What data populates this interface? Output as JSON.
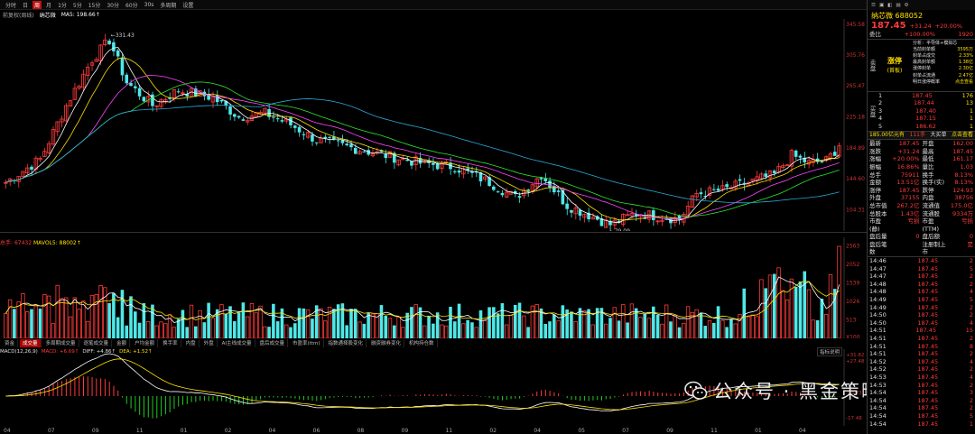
{
  "toolbar": {
    "items": [
      "分时",
      "日",
      "周",
      "月",
      "1分",
      "5分",
      "15分",
      "30分",
      "60分",
      "30s",
      "多周期",
      "设置"
    ],
    "active_index": 2
  },
  "titlebar": {
    "left": "前复权(周线)",
    "name": "纳芯微",
    "ma": "MA5: 198.66↑"
  },
  "main_chart": {
    "price_axis": [
      "345.58",
      "305.76",
      "265.47",
      "225.18",
      "184.89",
      "144.60",
      "104.31"
    ],
    "high_annotation": "←331.43",
    "low_annotation": "←79.09"
  },
  "vol_chart": {
    "title_prefix": "总手: ",
    "title_value": "67432",
    "title_ma": "MAVOL5: 88002↑",
    "axis": [
      "2563",
      "2052",
      "1539",
      "1026",
      "513",
      "X100"
    ]
  },
  "indicator_tabs": {
    "items": [
      "资金",
      "成交量",
      "多周期成交量",
      "逐笔成交量",
      "金额",
      "户均金额",
      "换手率",
      "内盘",
      "外盘",
      "AI主线成交量",
      "盘后成交量",
      "市盈率(ttm)",
      "指数通择股变化",
      "融资融券变化",
      "机构持仓数"
    ],
    "active_index": 1,
    "right_button": "指标说明"
  },
  "macd": {
    "prefix": "MACD(12,26,9)",
    "macd_val": "MACD: +6.69↑",
    "diff": "DIFF: +4.86↑",
    "dea": "DEA: +1.52↑",
    "axis": [
      "+31.82",
      "+27.48",
      "-13.73",
      "-17.48"
    ]
  },
  "dates": [
    "04",
    "07",
    "09",
    "11",
    "01",
    "02",
    "04",
    "06",
    "08",
    "09",
    "11",
    "02",
    "04",
    "05",
    "07",
    "09",
    "11",
    "01",
    "04"
  ],
  "chart_data": {
    "type": "candlestick",
    "y_range": [
      79.09,
      345.58
    ],
    "high": 331.43,
    "low": 79.09,
    "last_close": 187.45,
    "ma5": 198.66,
    "volume_last": 67432,
    "mavol5": 88002,
    "macd": 6.69,
    "diff": 4.86,
    "dea": 1.52
  },
  "quote": {
    "name": "纳芯微 688052",
    "price": "187.45",
    "change": "+31.24",
    "pct": "+20.00%",
    "weibi_label": "委比",
    "weibi": "+100.00%",
    "weibi_amt": "1920",
    "zt_label": "涨停",
    "zt_sub": "(首板)",
    "fenxi": "分析：半导体+模拟芯",
    "stats": [
      [
        "当前封单额",
        "3595万"
      ],
      [
        "封单占成交",
        "2.33%"
      ],
      [
        "最高封单额",
        "1.38亿"
      ],
      [
        "涨停封单",
        "2.30亿"
      ],
      [
        "封单占流通",
        "2.47亿"
      ],
      [
        "明日涨停概率",
        "点击查看"
      ]
    ],
    "side_sell": "卖盘",
    "side_buy": "买盘",
    "buy_levels": [
      [
        "1",
        "187.45",
        "176"
      ],
      [
        "2",
        "187.44",
        "13"
      ],
      [
        "3",
        "187.40",
        "1"
      ],
      [
        "4",
        "187.15",
        "1"
      ],
      [
        "5",
        "186.62",
        "1"
      ]
    ],
    "big_order": {
      "a": "185.00亿元有",
      "b": "111手",
      "c": "大买单",
      "d": "点击查看"
    },
    "fields": [
      [
        "最新",
        "187.45",
        "开盘",
        "162.00"
      ],
      [
        "涨跌",
        "+31.24",
        "最高",
        "187.45"
      ],
      [
        "涨幅",
        "+20.00%",
        "最低",
        "161.17"
      ],
      [
        "振幅",
        "16.86%",
        "量比",
        "1.03"
      ],
      [
        "总手",
        "75911",
        "换手",
        "8.13%"
      ],
      [
        "金额",
        "13.51亿",
        "换手(实)",
        "8.13%"
      ],
      [
        "涨停",
        "187.45",
        "跌停",
        "124.93"
      ],
      [
        "外盘",
        "37155",
        "内盘",
        "38756"
      ],
      [
        "总市值",
        "267.2亿",
        "流通值",
        "175.0亿"
      ],
      [
        "总股本",
        "1.43亿",
        "流通股",
        "9334万"
      ],
      [
        "市盈(静)",
        "亏损",
        "市盈(TTM)",
        "亏损"
      ],
      [
        "盘后量",
        "0",
        "盘后额",
        "0"
      ],
      [
        "盘后笔数",
        "",
        "注册制上市",
        "是"
      ]
    ],
    "ticks": [
      [
        "14:46",
        "187.45",
        "2"
      ],
      [
        "14:47",
        "187.45",
        "5"
      ],
      [
        "14:47",
        "187.45",
        "2"
      ],
      [
        "14:48",
        "187.45",
        "2"
      ],
      [
        "14:48",
        "187.45",
        "4"
      ],
      [
        "14:49",
        "187.45",
        "5"
      ],
      [
        "14:49",
        "187.45",
        "2"
      ],
      [
        "14:50",
        "187.45",
        "2"
      ],
      [
        "14:50",
        "187.45",
        "4"
      ],
      [
        "14:51",
        "187.45",
        "15"
      ],
      [
        "14:51",
        "187.45",
        "2"
      ],
      [
        "14:51",
        "187.45",
        "8"
      ],
      [
        "14:51",
        "187.45",
        "2"
      ],
      [
        "14:52",
        "187.45",
        "4"
      ],
      [
        "14:52",
        "187.45",
        "2"
      ],
      [
        "14:53",
        "187.45",
        "4"
      ],
      [
        "14:53",
        "187.45",
        "2"
      ],
      [
        "14:54",
        "187.45",
        "3"
      ],
      [
        "14:54",
        "187.45",
        "2"
      ],
      [
        "14:54",
        "187.45",
        "2"
      ],
      [
        "14:54",
        "187.45",
        "5"
      ],
      [
        "14:54",
        "187.45",
        "1"
      ]
    ]
  },
  "watermark": "公众号 · 黑金策略",
  "colors": {
    "up": "#ff3b3b",
    "down": "#4fe8e8",
    "ma5": "#ffffff",
    "ma10": "#ffe000",
    "ma20": "#ff44ff",
    "ma30": "#2ee62e",
    "ma60": "#2aa8d8"
  }
}
